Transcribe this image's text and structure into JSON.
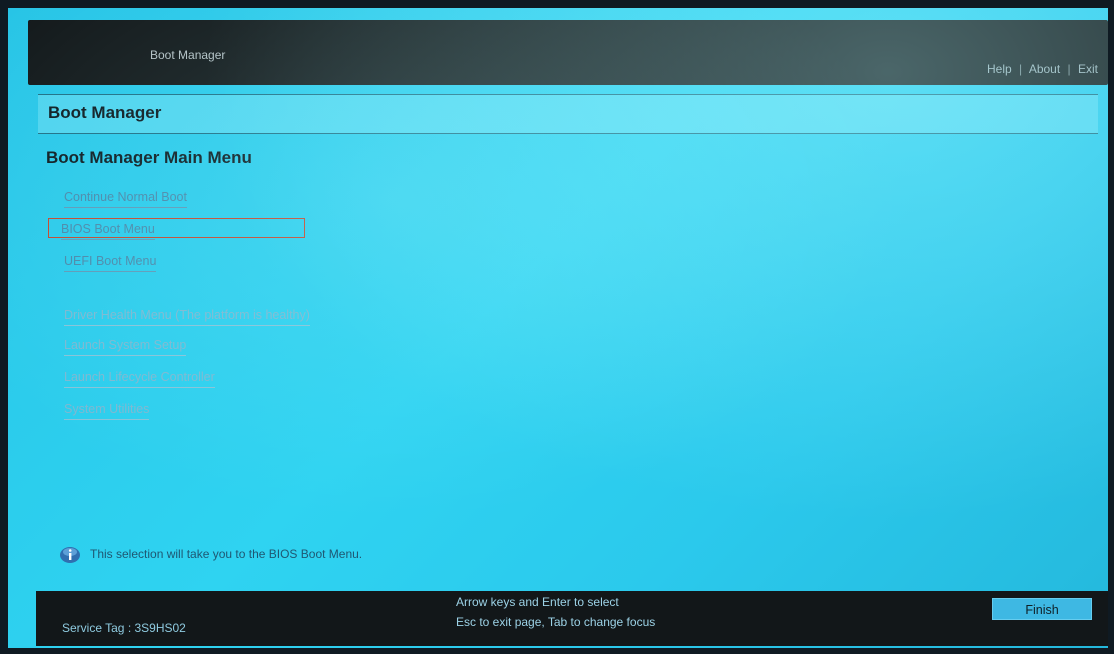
{
  "topbar": {
    "title": "Boot Manager",
    "links": [
      "Help",
      "About",
      "Exit"
    ],
    "separator": "|"
  },
  "page": {
    "header": "Boot Manager",
    "menu_title": "Boot Manager Main Menu"
  },
  "menu": {
    "items": [
      {
        "label": "Continue Normal Boot"
      },
      {
        "label": "BIOS Boot Menu"
      },
      {
        "label": "UEFI Boot Menu"
      },
      {
        "label": "Driver Health Menu (The platform is healthy)"
      },
      {
        "label": "Launch System Setup"
      },
      {
        "label": "Launch Lifecycle Controller"
      },
      {
        "label": "System Utilities"
      }
    ],
    "selected": "BIOS Boot Menu"
  },
  "info": {
    "text": "This selection will take you to the BIOS Boot Menu."
  },
  "footer": {
    "service_tag": "Service Tag : 3S9HS02",
    "hint_line1": "Arrow keys and Enter to select",
    "hint_line2": "Esc to exit page, Tab to change focus",
    "finish_label": "Finish"
  },
  "colors": {
    "background": "#2fd3f1",
    "bar": "#121719",
    "selection_border": "#c8452a",
    "finish_button": "#3eb8e3"
  }
}
